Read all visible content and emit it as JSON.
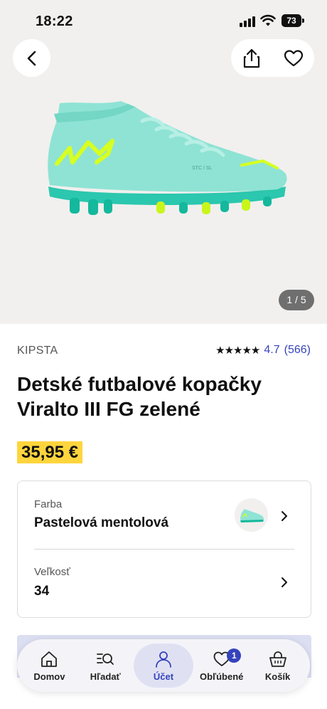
{
  "status_bar": {
    "time": "18:22",
    "battery": "73"
  },
  "gallery": {
    "pager": "1 / 5"
  },
  "product": {
    "brand": "KIPSTA",
    "rating_stars": "★★★★★",
    "rating_value": "4.7",
    "rating_count": "(566)",
    "title": "Detské futbalové kopačky Viralto III FG zelené",
    "price": "35,95 €"
  },
  "options": {
    "color": {
      "label": "Farba",
      "value": "Pastelová mentolová"
    },
    "size": {
      "label": "Veľkosť",
      "value": "34"
    }
  },
  "bottom_nav": {
    "items": [
      {
        "label": "Domov",
        "icon": "home-icon"
      },
      {
        "label": "Hľadať",
        "icon": "search-icon"
      },
      {
        "label": "Účet",
        "icon": "account-icon"
      },
      {
        "label": "Obľúbené",
        "icon": "heart-icon"
      },
      {
        "label": "Košík",
        "icon": "basket-icon"
      }
    ],
    "active_index": 2,
    "favorites_badge": "1"
  },
  "colors": {
    "accent": "#3643ba",
    "price_highlight": "#ffd53d",
    "shoe_mint": "#8fe3d4",
    "shoe_neon": "#d7ff1f"
  }
}
